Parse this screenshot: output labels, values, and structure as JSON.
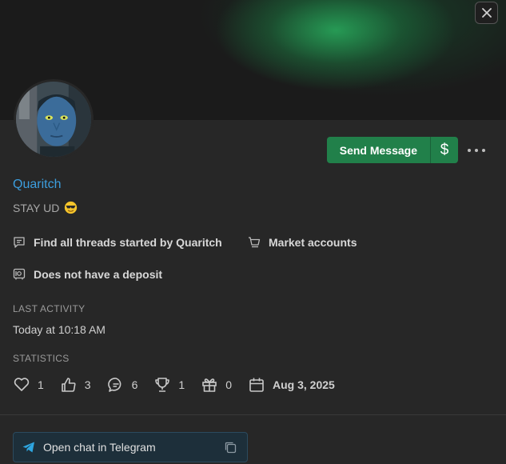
{
  "profile": {
    "username": "Quaritch",
    "status_text": "STAY UD",
    "status_emoji": "sunglasses-emoji"
  },
  "actions": {
    "send_message": "Send Message",
    "pay_symbol": "$"
  },
  "links": {
    "threads": "Find all threads started by Quaritch",
    "market": "Market accounts",
    "deposit": "Does not have a deposit"
  },
  "last_activity": {
    "label": "LAST ACTIVITY",
    "value": "Today at 10:18 AM"
  },
  "statistics": {
    "label": "STATISTICS",
    "likes": "1",
    "thumbs": "3",
    "messages": "6",
    "trophies": "1",
    "gifts": "0",
    "joined": "Aug 3, 2025"
  },
  "telegram": {
    "label": "Open chat in Telegram"
  },
  "colors": {
    "accent_green": "#21804a",
    "username_blue": "#3c9ede",
    "background": "#272727"
  }
}
